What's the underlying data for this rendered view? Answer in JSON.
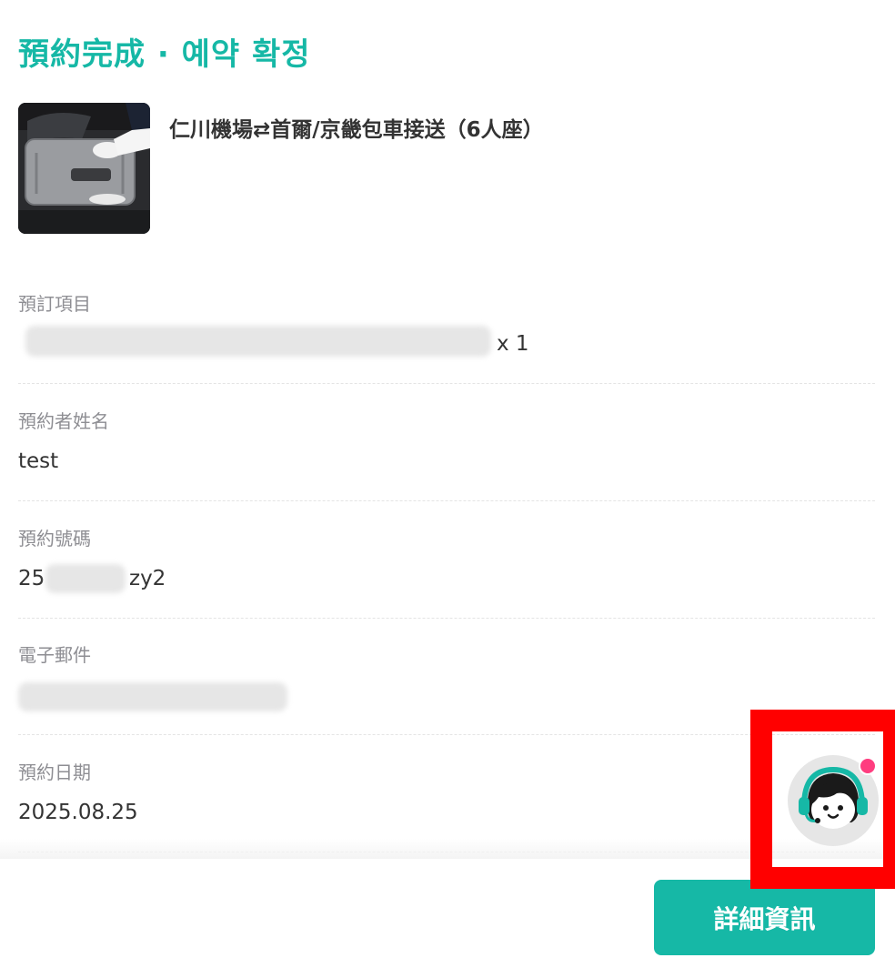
{
  "header": {
    "title": "預約完成 · 예약 확정"
  },
  "product": {
    "name": "仁川機場⇄首爾/京畿包車接送（6人座）",
    "image_icon": "luggage-photo"
  },
  "fields": {
    "item": {
      "label": "預訂項目",
      "quantity": "x 1"
    },
    "booker": {
      "label": "預約者姓名",
      "value": "test"
    },
    "booking_no": {
      "label": "預約號碼",
      "prefix": "25",
      "suffix": "zy2"
    },
    "email": {
      "label": "電子郵件"
    },
    "date": {
      "label": "預約日期",
      "value": "2025.08.25"
    }
  },
  "actions": {
    "detail_label": "詳細資訊"
  },
  "support": {
    "icon": "customer-support-agent-icon",
    "has_notification": true
  },
  "colors": {
    "accent": "#16b8a6",
    "notification": "#ff3d7f",
    "highlight": "#ff0000",
    "label": "#8e8e93",
    "text": "#333333"
  }
}
